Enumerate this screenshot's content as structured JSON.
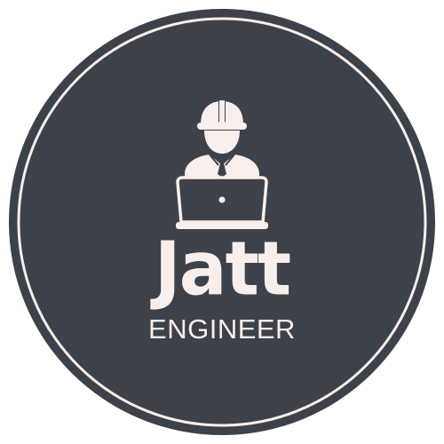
{
  "logo": {
    "name": "Jatt",
    "subtitle": "ENGINEER",
    "icon": "engineer-with-laptop-icon",
    "colors": {
      "background": "#ffffff",
      "badge": "#3c414a",
      "foreground": "#f8efec"
    }
  }
}
